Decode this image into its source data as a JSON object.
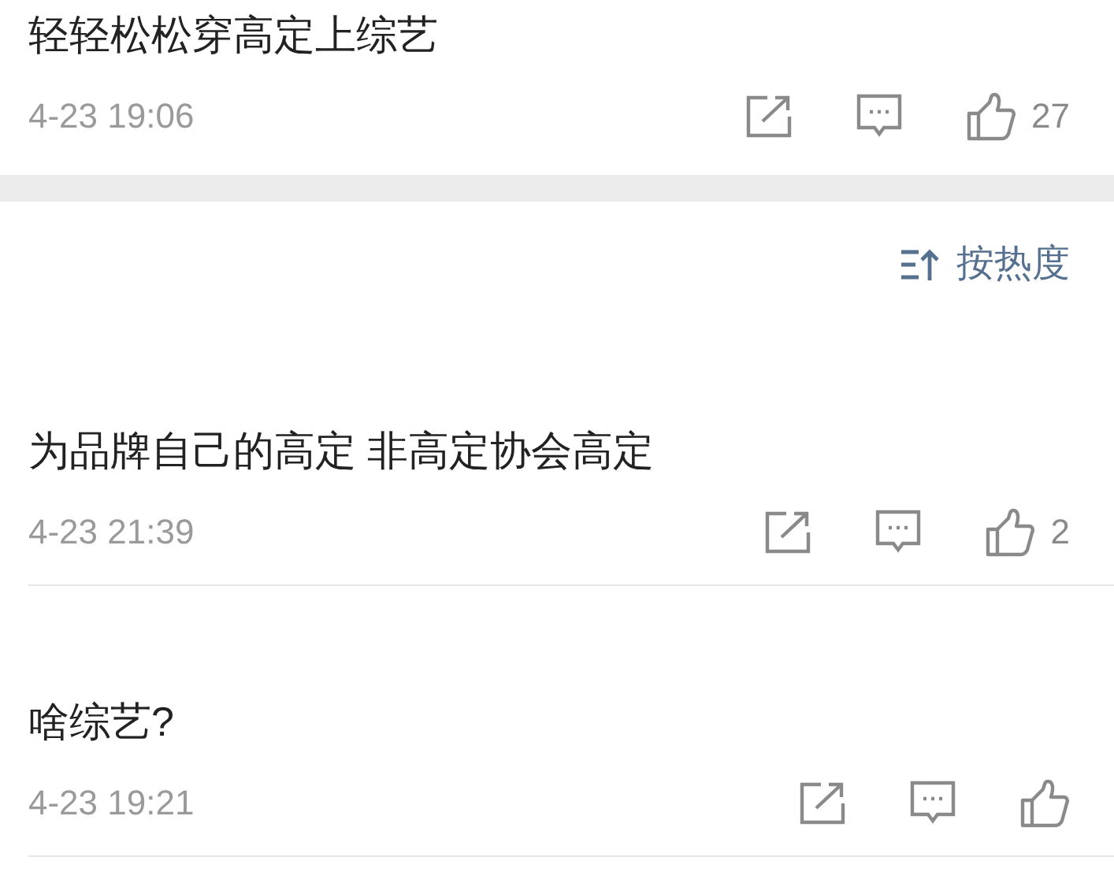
{
  "top_comment": {
    "text": "轻轻松松穿高定上综艺",
    "time": "4-23 19:06",
    "likes": "27"
  },
  "sort": {
    "label": "按热度"
  },
  "comments": [
    {
      "text": "为品牌自己的高定 非高定协会高定",
      "time": "4-23 21:39",
      "likes": "2"
    },
    {
      "text": "啥综艺?",
      "time": "4-23 19:21"
    }
  ]
}
